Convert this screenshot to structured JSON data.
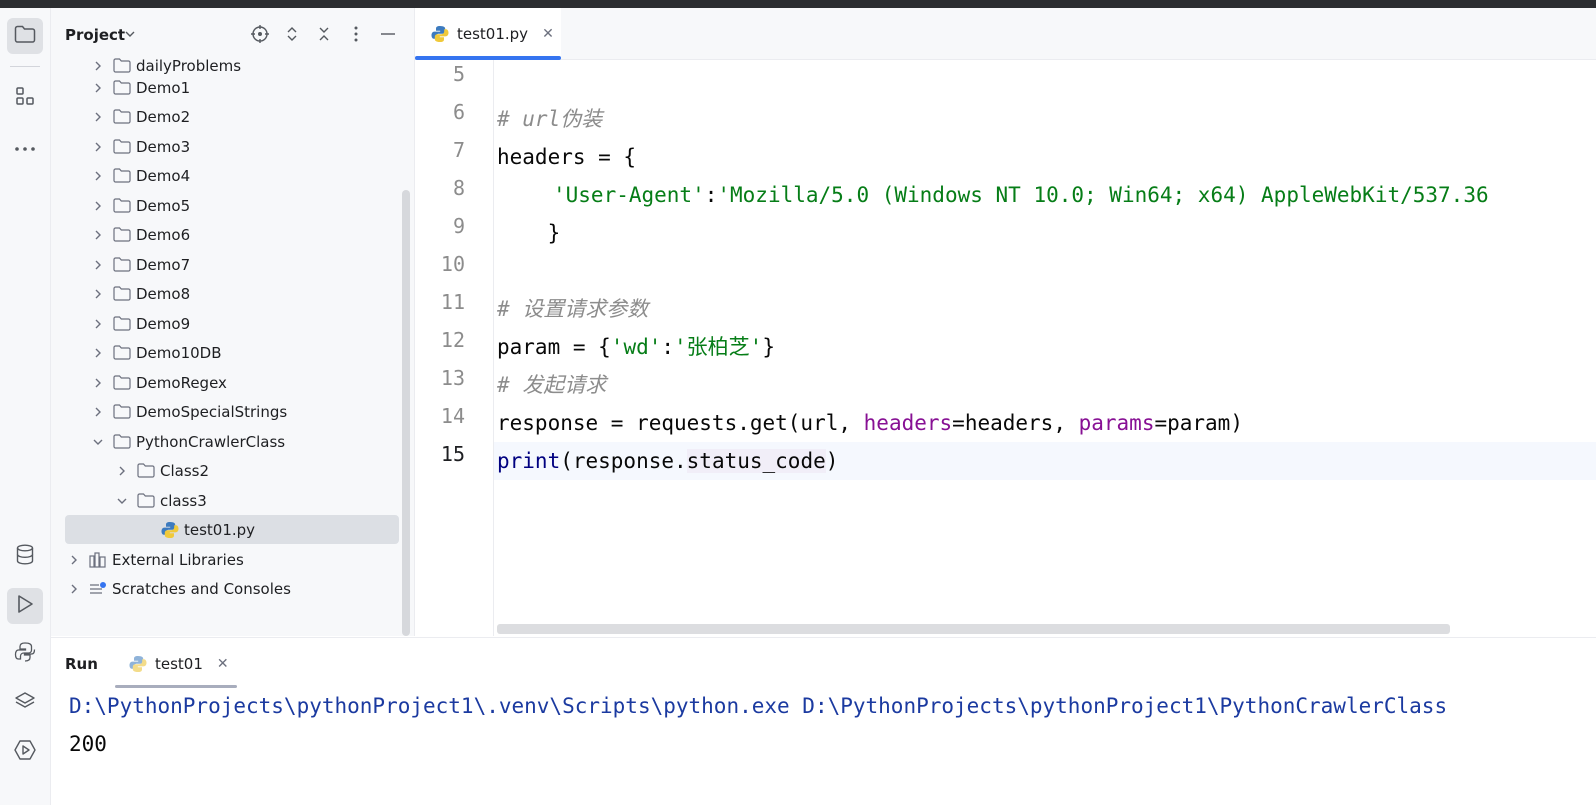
{
  "project_panel": {
    "title": "Project",
    "tree": [
      {
        "label": "dailyProblems",
        "depth": 1,
        "expanded": false
      },
      {
        "label": "Demo1",
        "depth": 1,
        "expanded": false
      },
      {
        "label": "Demo2",
        "depth": 1,
        "expanded": false
      },
      {
        "label": "Demo3",
        "depth": 1,
        "expanded": false
      },
      {
        "label": "Demo4",
        "depth": 1,
        "expanded": false
      },
      {
        "label": "Demo5",
        "depth": 1,
        "expanded": false
      },
      {
        "label": "Demo6",
        "depth": 1,
        "expanded": false
      },
      {
        "label": "Demo7",
        "depth": 1,
        "expanded": false
      },
      {
        "label": "Demo8",
        "depth": 1,
        "expanded": false
      },
      {
        "label": "Demo9",
        "depth": 1,
        "expanded": false
      },
      {
        "label": "Demo10DB",
        "depth": 1,
        "expanded": false
      },
      {
        "label": "DemoRegex",
        "depth": 1,
        "expanded": false
      },
      {
        "label": "DemoSpecialStrings",
        "depth": 1,
        "expanded": false
      },
      {
        "label": "PythonCrawlerClass",
        "depth": 1,
        "expanded": true
      },
      {
        "label": "Class2",
        "depth": 2,
        "expanded": false
      },
      {
        "label": "class3",
        "depth": 2,
        "expanded": true
      },
      {
        "label": "test01.py",
        "depth": 3,
        "type": "python",
        "selected": true
      },
      {
        "label": "External Libraries",
        "depth": 0,
        "type": "libraries",
        "expanded": false
      },
      {
        "label": "Scratches and Consoles",
        "depth": 0,
        "type": "scratches",
        "expanded": false
      }
    ]
  },
  "editor": {
    "tab_label": "test01.py",
    "line_numbers": [
      "5",
      "6",
      "7",
      "8",
      "9",
      "10",
      "11",
      "12",
      "13",
      "14",
      "15"
    ],
    "code": {
      "l6_comment": "# url伪装",
      "l7": "headers = {",
      "l8_key": "'User-Agent'",
      "l8_colon": ":",
      "l8_value": "'Mozilla/5.0 (Windows NT 10.0; Win64; x64) AppleWebKit/537.36",
      "l9": "    }",
      "l11_comment": "# 设置请求参数",
      "l12_a": "param = {",
      "l12_key": "'wd'",
      "l12_colon": ":",
      "l12_val": "'张柏芝'",
      "l12_b": "}",
      "l13_comment": "# 发起请求",
      "l14_a": "response = requests.get(url, ",
      "l14_kw1": "headers",
      "l14_b": "=headers, ",
      "l14_kw2": "params",
      "l14_c": "=param)",
      "l15_fn": "print",
      "l15_a": "(response.",
      "l15_attr": "status_code",
      "l15_b": ")"
    }
  },
  "run_panel": {
    "title": "Run",
    "tab_label": "test01",
    "console_cmd": "D:\\PythonProjects\\pythonProject1\\.venv\\Scripts\\python.exe D:\\PythonProjects\\pythonProject1\\PythonCrawlerClass",
    "console_output": "200"
  },
  "colors": {
    "accent": "#3574f0",
    "comment": "#8c8c8c",
    "string": "#067d17",
    "keyword_arg": "#871094",
    "console_path": "#1b3aa0"
  },
  "icons": [
    "folder-icon",
    "structure-icon",
    "more-icon",
    "database-icon",
    "run-icon",
    "python-console-icon",
    "layers-icon",
    "services-icon",
    "locate-icon",
    "expand-all-icon",
    "collapse-all-icon",
    "options-icon",
    "hide-icon"
  ]
}
